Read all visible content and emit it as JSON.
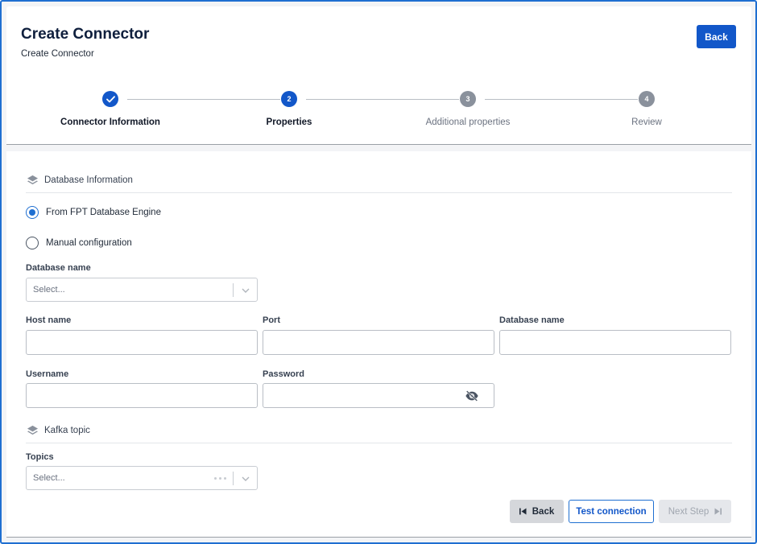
{
  "header": {
    "title": "Create Connector",
    "subtitle": "Create Connector",
    "back_label": "Back"
  },
  "stepper": {
    "steps": [
      {
        "number": "1",
        "label": "Connector Information",
        "state": "done"
      },
      {
        "number": "2",
        "label": "Properties",
        "state": "active"
      },
      {
        "number": "3",
        "label": "Additional properties",
        "state": "todo"
      },
      {
        "number": "4",
        "label": "Review",
        "state": "todo"
      }
    ]
  },
  "database_section": {
    "title": "Database Information",
    "icon": "layers-icon",
    "options": [
      {
        "label": "From FPT Database Engine",
        "checked": true
      },
      {
        "label": "Manual configuration",
        "checked": false
      }
    ],
    "database_select": {
      "label": "Database name",
      "placeholder": "Select..."
    },
    "host": {
      "label": "Host name",
      "value": ""
    },
    "port": {
      "label": "Port",
      "value": ""
    },
    "database_name": {
      "label": "Database name",
      "value": ""
    },
    "username": {
      "label": "Username",
      "value": ""
    },
    "password": {
      "label": "Password",
      "value": "",
      "icon": "eye-off-icon"
    }
  },
  "kafka_section": {
    "title": "Kafka topic",
    "icon": "layers-icon",
    "topics": {
      "label": "Topics",
      "placeholder": "Select..."
    }
  },
  "footer": {
    "back_label": "Back",
    "test_label": "Test connection",
    "next_label": "Next Step"
  },
  "colors": {
    "accent": "#1257c9",
    "frame": "#1f6fd1",
    "step_todo": "#8a919c"
  }
}
